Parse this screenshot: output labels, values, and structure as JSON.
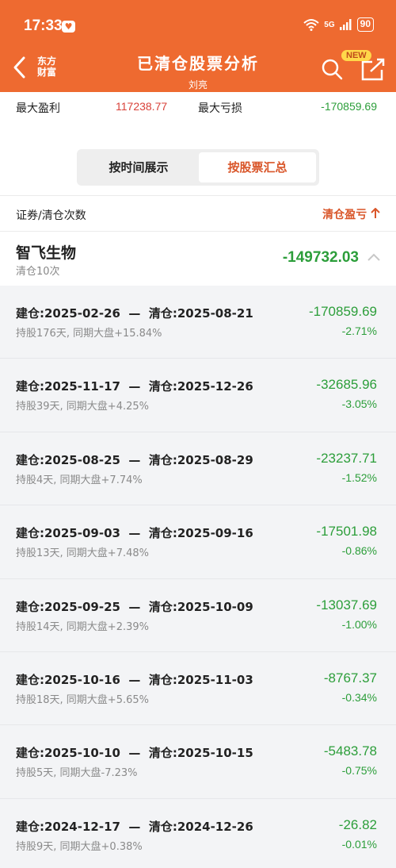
{
  "status": {
    "time": "17:33",
    "network": "5G",
    "battery": "90"
  },
  "header": {
    "back_icon": "chevron-left-icon",
    "logo_line1": "东方",
    "logo_line2": "财富",
    "title": "已清仓股票分析",
    "subtitle": "刘亮",
    "new_badge": "NEW"
  },
  "top_stats": {
    "max_profit_label": "最大盈利",
    "max_profit_value": "117238.77",
    "max_loss_label": "最大亏损",
    "max_loss_value": "-170859.69"
  },
  "toggle": {
    "by_time": "按时间展示",
    "by_stock": "按股票汇总"
  },
  "columns": {
    "left": "证券/清仓次数",
    "right": "清仓盈亏"
  },
  "summary": {
    "name": "智飞生物",
    "count": "清仓10次",
    "total": "-149732.03"
  },
  "trades": [
    {
      "dates": "建仓:2025-02-26  —  清仓:2025-08-21",
      "hold": "持股176天, 同期大盘+15.84%",
      "amount": "-170859.69",
      "pct": "-2.71%"
    },
    {
      "dates": "建仓:2025-11-17  —  清仓:2025-12-26",
      "hold": "持股39天, 同期大盘+4.25%",
      "amount": "-32685.96",
      "pct": "-3.05%"
    },
    {
      "dates": "建仓:2025-08-25  —  清仓:2025-08-29",
      "hold": "持股4天, 同期大盘+7.74%",
      "amount": "-23237.71",
      "pct": "-1.52%"
    },
    {
      "dates": "建仓:2025-09-03  —  清仓:2025-09-16",
      "hold": "持股13天, 同期大盘+7.48%",
      "amount": "-17501.98",
      "pct": "-0.86%"
    },
    {
      "dates": "建仓:2025-09-25  —  清仓:2025-10-09",
      "hold": "持股14天, 同期大盘+2.39%",
      "amount": "-13037.69",
      "pct": "-1.00%"
    },
    {
      "dates": "建仓:2025-10-16  —  清仓:2025-11-03",
      "hold": "持股18天, 同期大盘+5.65%",
      "amount": "-8767.37",
      "pct": "-0.34%"
    },
    {
      "dates": "建仓:2025-10-10  —  清仓:2025-10-15",
      "hold": "持股5天, 同期大盘-7.23%",
      "amount": "-5483.78",
      "pct": "-0.75%"
    },
    {
      "dates": "建仓:2024-12-17  —  清仓:2024-12-26",
      "hold": "持股9天, 同期大盘+0.38%",
      "amount": "-26.82",
      "pct": "-0.01%"
    }
  ],
  "colors": {
    "brand": "#ee6a30",
    "loss": "#2c9e3a",
    "profit": "#d9423a",
    "accent": "#d9562a"
  }
}
